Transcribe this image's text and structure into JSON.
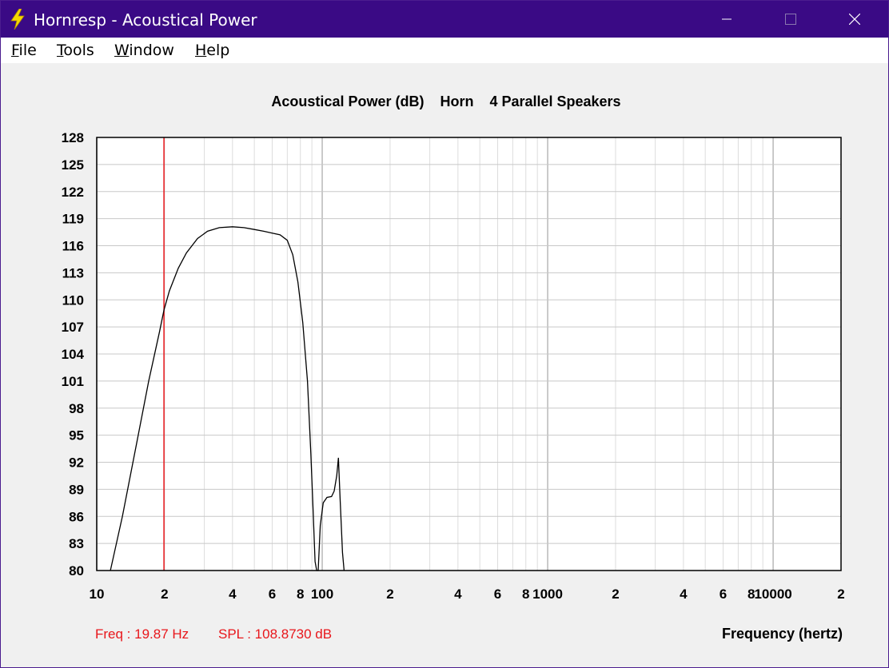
{
  "window": {
    "title": "Hornresp - Acoustical Power",
    "controls": {
      "minimize": "—",
      "maximize": "☐",
      "close": "✕"
    }
  },
  "menu": [
    {
      "label": "File",
      "accel": "F",
      "rest": "ile"
    },
    {
      "label": "Tools",
      "accel": "T",
      "rest": "ools"
    },
    {
      "label": "Window",
      "accel": "W",
      "rest": "indow"
    },
    {
      "label": "Help",
      "accel": "H",
      "rest": "elp"
    }
  ],
  "status": {
    "freq": "Freq : 19.87 Hz",
    "spl": "SPL : 108.8730 dB"
  },
  "colors": {
    "titlebar": "#3a0a85",
    "cursor": "#e8161b",
    "curve": "#000000",
    "grid": "#c8c8c8",
    "status_text": "#e8161b"
  },
  "chart_data": {
    "type": "line",
    "title": "Acoustical Power (dB)    Horn    4 Parallel Speakers",
    "xlabel": "Frequency (hertz)",
    "ylabel": "",
    "xscale": "log",
    "xlim": [
      10,
      20000
    ],
    "ylim": [
      80,
      128
    ],
    "yticks": [
      128,
      125,
      122,
      119,
      116,
      113,
      110,
      107,
      104,
      101,
      98,
      95,
      92,
      89,
      86,
      83,
      80
    ],
    "xtick_labels": [
      {
        "x": 10,
        "label": "10"
      },
      {
        "x": 20,
        "label": "2"
      },
      {
        "x": 40,
        "label": "4"
      },
      {
        "x": 60,
        "label": "6"
      },
      {
        "x": 80,
        "label": "8"
      },
      {
        "x": 100,
        "label": "100"
      },
      {
        "x": 200,
        "label": "2"
      },
      {
        "x": 400,
        "label": "4"
      },
      {
        "x": 600,
        "label": "6"
      },
      {
        "x": 800,
        "label": "8"
      },
      {
        "x": 1000,
        "label": "1000"
      },
      {
        "x": 2000,
        "label": "2"
      },
      {
        "x": 4000,
        "label": "4"
      },
      {
        "x": 6000,
        "label": "6"
      },
      {
        "x": 8000,
        "label": "8"
      },
      {
        "x": 10000,
        "label": "10000"
      },
      {
        "x": 20000,
        "label": "2"
      }
    ],
    "cursor_x": 19.87,
    "series": [
      {
        "points": [
          [
            11.5,
            80
          ],
          [
            13,
            86
          ],
          [
            15,
            94
          ],
          [
            17,
            101
          ],
          [
            19,
            106.5
          ],
          [
            19.87,
            108.87
          ],
          [
            21,
            111
          ],
          [
            23,
            113.5
          ],
          [
            25,
            115.2
          ],
          [
            28,
            116.8
          ],
          [
            31,
            117.6
          ],
          [
            35,
            118.0
          ],
          [
            40,
            118.1
          ],
          [
            45,
            118.0
          ],
          [
            50,
            117.8
          ],
          [
            55,
            117.6
          ],
          [
            60,
            117.4
          ],
          [
            65,
            117.2
          ],
          [
            70,
            116.6
          ],
          [
            74,
            115.0
          ],
          [
            78,
            112.0
          ],
          [
            82,
            107.5
          ],
          [
            86,
            101.0
          ],
          [
            89,
            93.0
          ],
          [
            91,
            87.0
          ],
          [
            93,
            81.0
          ],
          [
            94.5,
            80
          ],
          [
            96,
            80
          ],
          [
            98,
            85
          ],
          [
            101,
            87.5
          ],
          [
            105,
            88.1
          ],
          [
            110,
            88.2
          ],
          [
            113,
            88.8
          ],
          [
            116,
            90.5
          ],
          [
            118,
            92.5
          ],
          [
            120,
            88.0
          ],
          [
            123,
            82.0
          ],
          [
            125,
            80
          ]
        ]
      }
    ]
  }
}
